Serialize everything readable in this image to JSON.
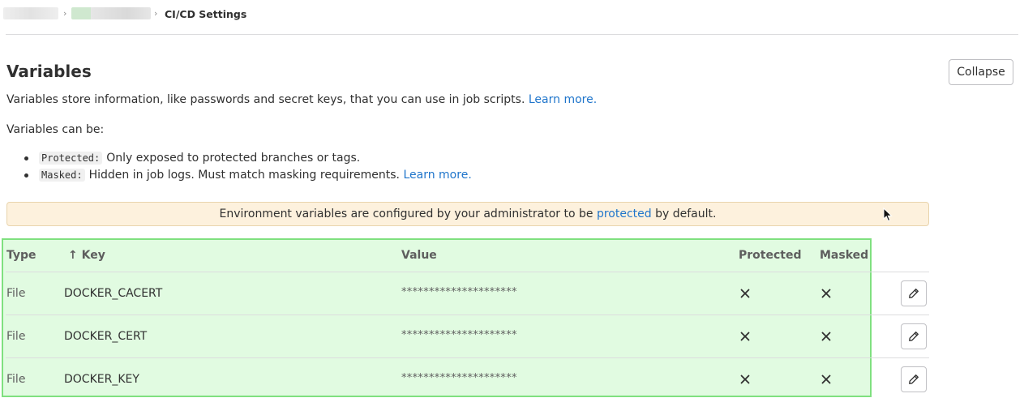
{
  "breadcrumb": {
    "separator": "›",
    "current": "CI/CD Settings"
  },
  "section": {
    "title": "Variables",
    "collapse_label": "Collapse",
    "description": "Variables store information, like passwords and secret keys, that you can use in job scripts.",
    "learn_more": "Learn more.",
    "can_be": "Variables can be:",
    "bullets": [
      {
        "code": "Protected:",
        "text": "Only exposed to protected branches or tags.",
        "link": ""
      },
      {
        "code": "Masked:",
        "text": "Hidden in job logs. Must match masking requirements.",
        "link": "Learn more."
      }
    ]
  },
  "alert": {
    "before": "Environment variables are configured by your administrator to be",
    "link": "protected",
    "after": "by default."
  },
  "table": {
    "headers": {
      "type": "Type",
      "key": "↑ Key",
      "value": "Value",
      "protected": "Protected",
      "masked": "Masked"
    },
    "rows": [
      {
        "type": "File",
        "key": "DOCKER_CACERT",
        "value": "*********************",
        "protected": "false",
        "masked": "false"
      },
      {
        "type": "File",
        "key": "DOCKER_CERT",
        "value": "*********************",
        "protected": "false",
        "masked": "false"
      },
      {
        "type": "File",
        "key": "DOCKER_KEY",
        "value": "*********************",
        "protected": "false",
        "masked": "false"
      }
    ]
  },
  "icons": {
    "false_icon": "close-icon",
    "edit_icon": "pencil-icon"
  },
  "colors": {
    "link": "#1f75cb",
    "alert_bg": "#fdf1dd",
    "highlight_bg": "#e1fbe1",
    "highlight_border": "#7fe07f"
  }
}
